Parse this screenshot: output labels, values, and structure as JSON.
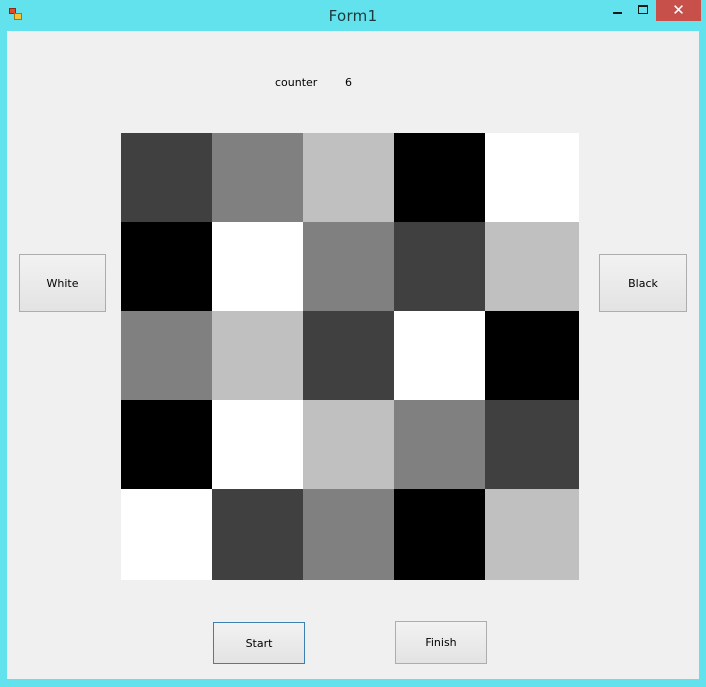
{
  "window": {
    "title": "Form1",
    "close_glyph": "✕"
  },
  "counter": {
    "label": "counter",
    "value": "6"
  },
  "buttons": {
    "white": "White",
    "black": "Black",
    "start": "Start",
    "finish": "Finish"
  },
  "board": {
    "rows": 5,
    "cols": 5,
    "cells": [
      [
        "#404040",
        "#808080",
        "#c0c0c0",
        "#000000",
        "#ffffff"
      ],
      [
        "#000000",
        "#ffffff",
        "#808080",
        "#404040",
        "#c0c0c0"
      ],
      [
        "#808080",
        "#c0c0c0",
        "#404040",
        "#ffffff",
        "#000000"
      ],
      [
        "#000000",
        "#ffffff",
        "#c0c0c0",
        "#808080",
        "#404040"
      ],
      [
        "#ffffff",
        "#404040",
        "#808080",
        "#000000",
        "#c0c0c0"
      ]
    ]
  },
  "colors": {
    "frame": "#62e2ec",
    "client": "#f0f0f0",
    "close_button": "#c7504b"
  },
  "icons": {
    "app": "app-icon",
    "minimize": "minimize-icon",
    "maximize": "maximize-icon",
    "close": "close-icon"
  }
}
